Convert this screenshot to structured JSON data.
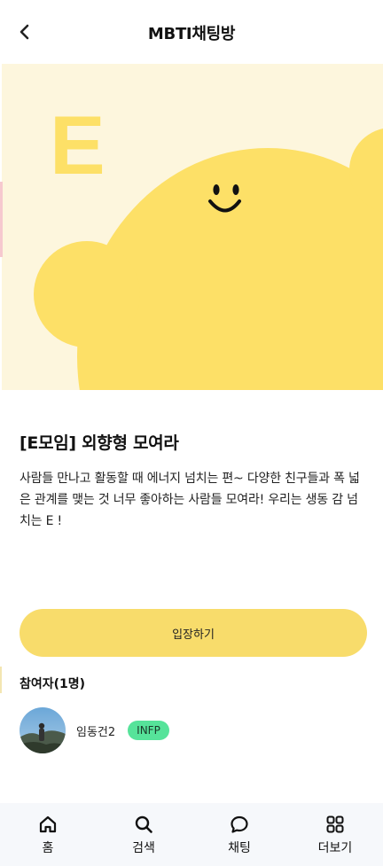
{
  "header": {
    "title": "MBTI채팅방",
    "back_icon": "chevron-left-icon"
  },
  "hero": {
    "letter": "E",
    "colors": {
      "background": "#fdf6dd",
      "character": "#fde067"
    }
  },
  "room": {
    "title": "[E모임] 외향형 모여라",
    "description": "사람들 만나고 활동할 때 에너지 넘치는 편~ 다양한 친구들과 폭 넓은 관계를 맺는 것 너무 좋아하는 사람들 모여라! 우리는 생동 감 넘치는 E !"
  },
  "enter_button": {
    "label": "입장하기",
    "color": "#f8dc6b"
  },
  "participants": {
    "title": "참여자(1명)",
    "items": [
      {
        "name": "임동건2",
        "mbti": "INFP",
        "badge_color": "#56e39a"
      }
    ]
  },
  "bottom_nav": {
    "items": [
      {
        "label": "홈",
        "icon": "home-icon"
      },
      {
        "label": "검색",
        "icon": "search-icon"
      },
      {
        "label": "채팅",
        "icon": "chat-bubble-icon"
      },
      {
        "label": "더보기",
        "icon": "grid-more-icon"
      }
    ]
  }
}
